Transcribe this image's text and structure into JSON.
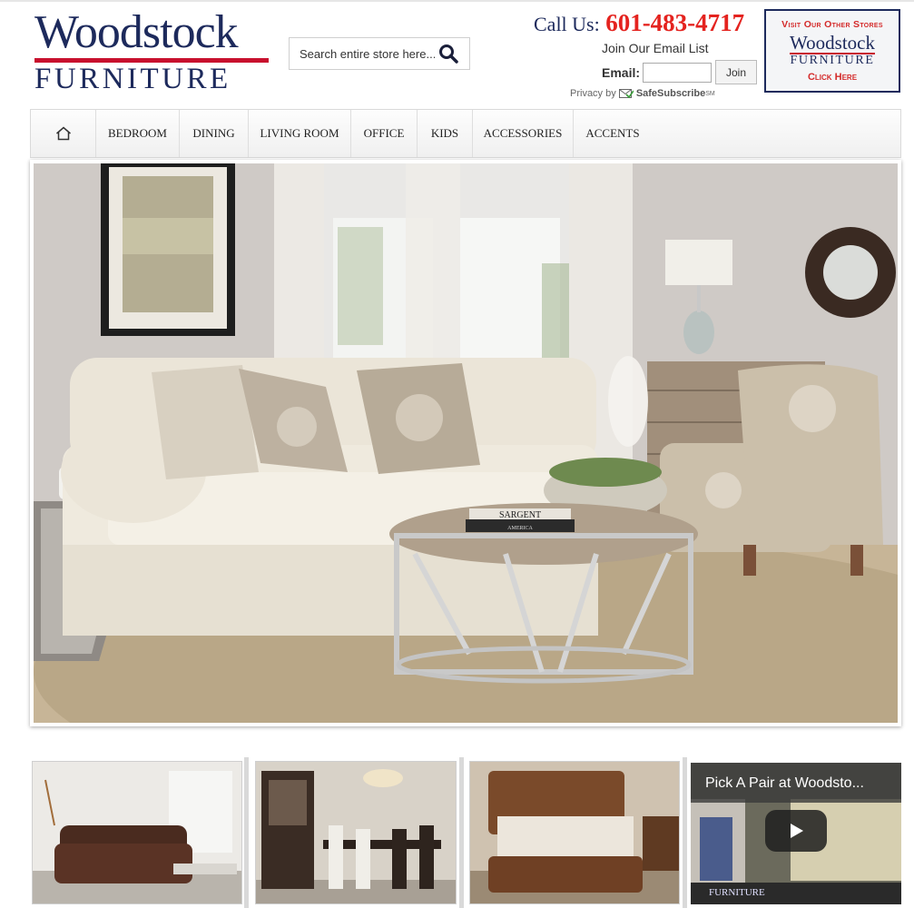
{
  "header": {
    "logo_main": "Woodstock",
    "logo_sub": "FURNITURE",
    "search_placeholder": "Search entire store here...",
    "call_label": "Call Us:",
    "call_number": "601-483-4717",
    "email_title": "Join Our Email List",
    "email_label": "Email:",
    "join_label": "Join",
    "privacy_label": "Privacy",
    "privacy_by": "by",
    "safesubscribe": "SafeSubscribe",
    "safesubscribe_mark": "SM"
  },
  "other_stores": {
    "top": "Visit Our Other Stores",
    "logo_main": "Woodstock",
    "logo_sub": "FURNITURE",
    "click": "Click Here"
  },
  "nav": {
    "items": [
      "BEDROOM",
      "DINING",
      "LIVING ROOM",
      "OFFICE",
      "KIDS",
      "ACCESSORIES",
      "ACCENTS"
    ]
  },
  "hero": {
    "book_spine": "SARGENT",
    "book_small": "AMERICA"
  },
  "video": {
    "title": "Pick A Pair at Woodsto...",
    "caption_brand": "FURNITURE"
  },
  "colors": {
    "brand_navy": "#1d2a5c",
    "brand_red": "#c8102e",
    "phone_red": "#e4231f"
  },
  "icons": {
    "home": "home-icon",
    "search": "search-icon",
    "play": "play-icon",
    "envelope": "envelope-check-icon"
  }
}
